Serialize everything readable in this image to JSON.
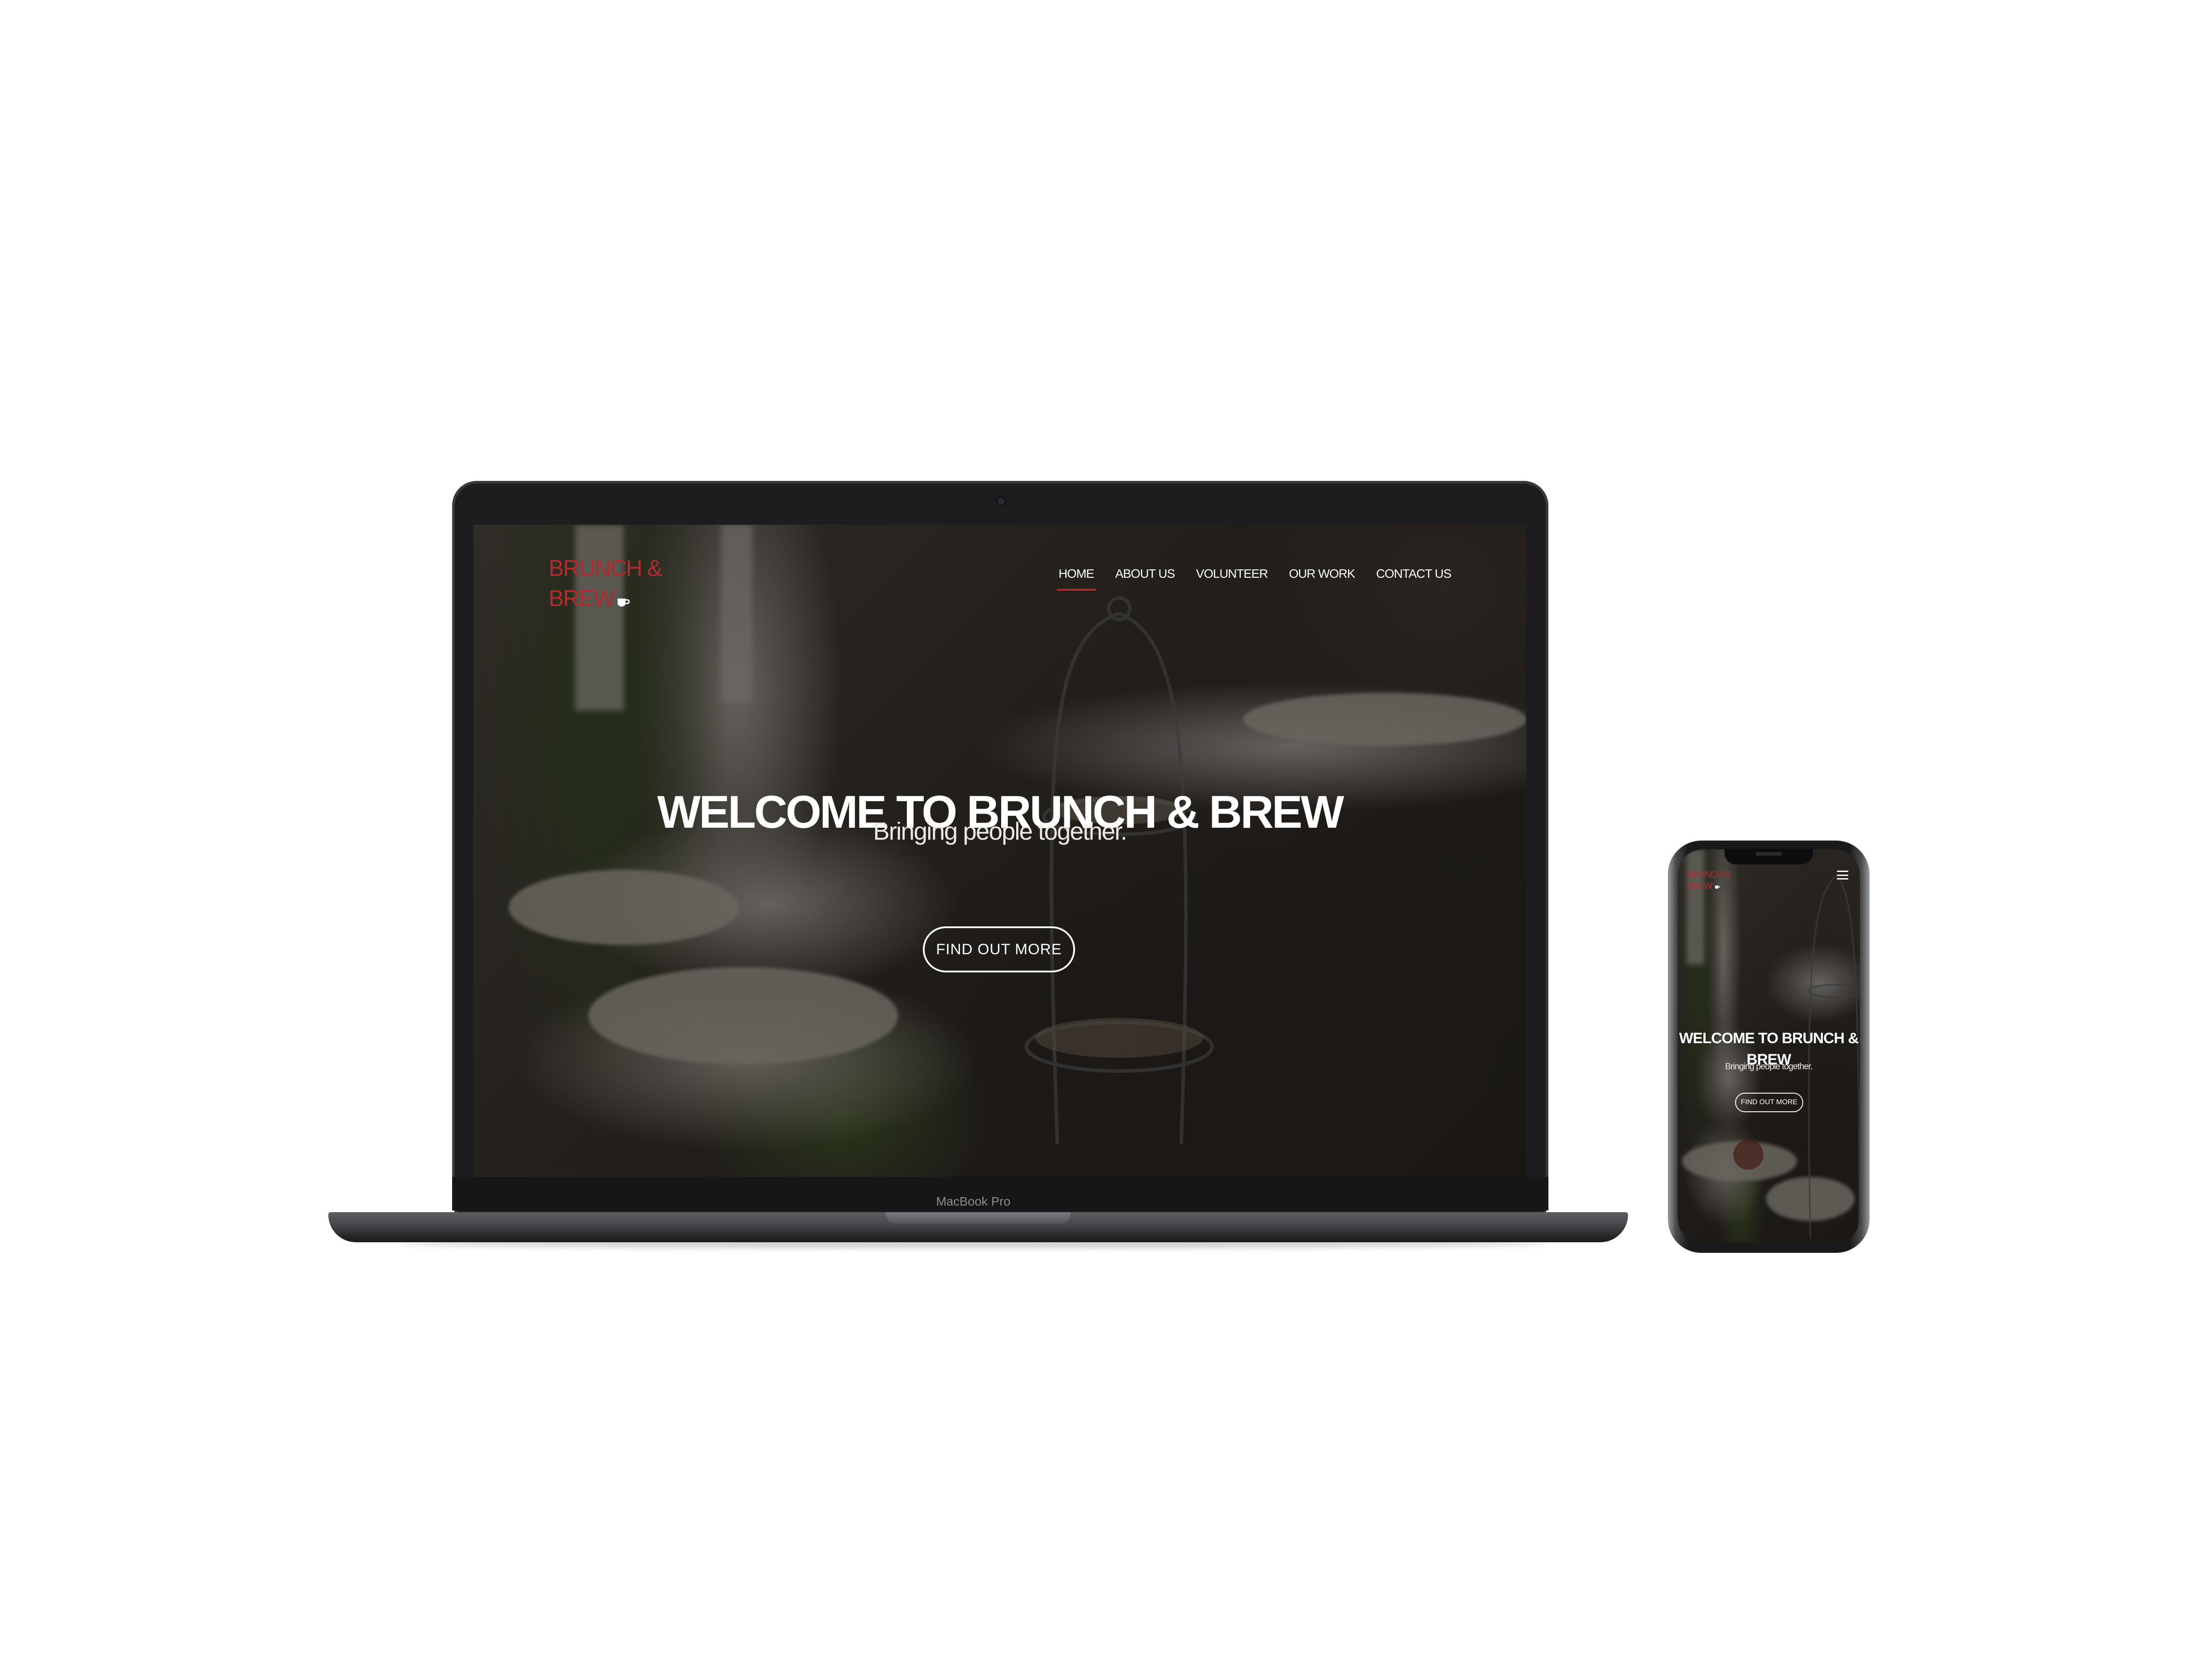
{
  "site": {
    "logo_line1": "BRUNCH &",
    "logo_line2": "BREW",
    "nav": [
      {
        "label": "HOME",
        "active": true
      },
      {
        "label": "ABOUT US",
        "active": false
      },
      {
        "label": "VOLUNTEER",
        "active": false
      },
      {
        "label": "OUR WORK",
        "active": false
      },
      {
        "label": "CONTACT US",
        "active": false
      }
    ],
    "hero_title": "WELCOME TO BRUNCH & BREW",
    "hero_subtitle": "Bringing people together.",
    "cta_label": "FIND OUT MORE"
  },
  "mobile": {
    "logo_line1": "BRUNCH &",
    "logo_line2": "BREW",
    "hero_title": "WELCOME TO BRUNCH & BREW",
    "hero_subtitle": "Bringing people together.",
    "cta_label": "FIND OUT MORE"
  },
  "device": {
    "laptop_label": "MacBook Pro"
  },
  "colors": {
    "brand_red": "#b02a2e",
    "page_bg": "#ffffff",
    "overlay": "#12100e"
  },
  "icons": {
    "logo_cup": "coffee-cup-icon",
    "mobile_menu": "hamburger-menu-icon"
  }
}
